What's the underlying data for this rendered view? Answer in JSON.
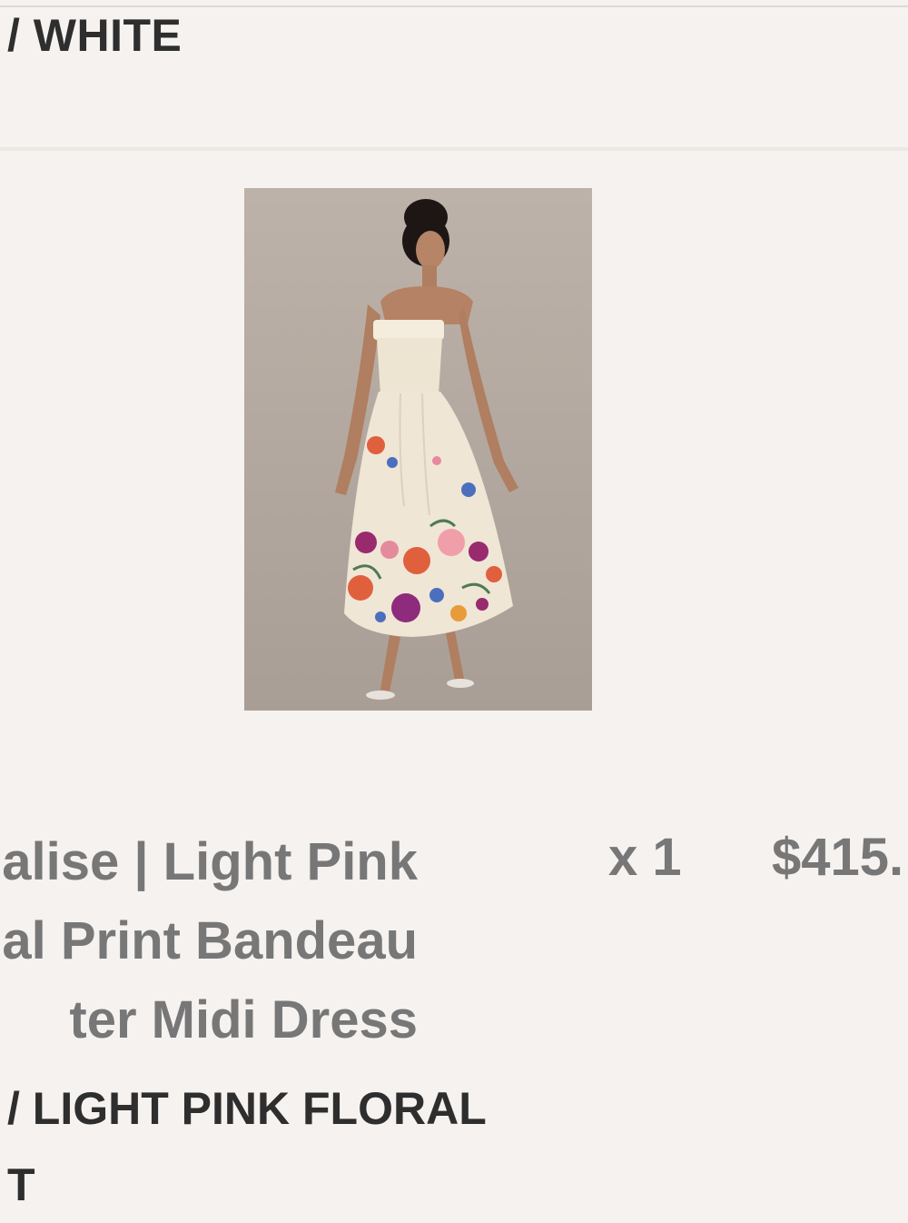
{
  "previous_item": {
    "variant": "/ WHITE"
  },
  "line_item": {
    "image_alt": "Model wearing a strapless white bandeau midi dress with a light pink floral print hem",
    "name": "alise | Light Pink\nal Print Bandeau\nter Midi Dress",
    "quantity": "x 1",
    "price": "$415.",
    "variant": "/ LIGHT PINK FLORAL\nT"
  }
}
